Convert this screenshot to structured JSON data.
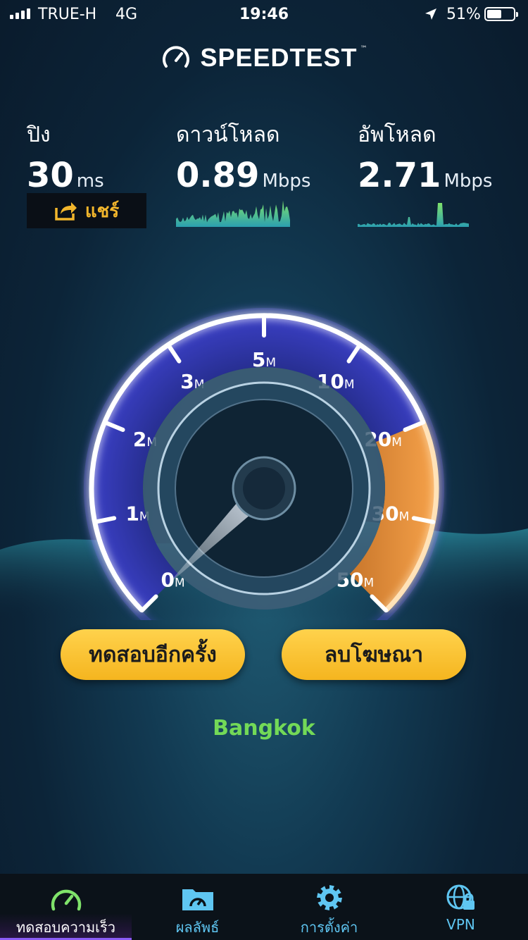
{
  "status": {
    "carrier": "TRUE-H",
    "network": "4G",
    "time": "19:46",
    "battery": "51%",
    "battery_level": 0.51
  },
  "app": {
    "title": "SPEEDTEST",
    "tm": "™"
  },
  "ping": {
    "label": "ปิง",
    "value": "30",
    "unit": "ms"
  },
  "download": {
    "label": "ดาวน์โหลด",
    "value": "0.89",
    "unit": "Mbps"
  },
  "upload": {
    "label": "อัพโหลด",
    "value": "2.71",
    "unit": "Mbps"
  },
  "share": {
    "label": "แชร์"
  },
  "gauge": {
    "ticks": [
      {
        "n": "0",
        "u": "M"
      },
      {
        "n": "1",
        "u": "M"
      },
      {
        "n": "2",
        "u": "M"
      },
      {
        "n": "3",
        "u": "M"
      },
      {
        "n": "5",
        "u": "M"
      },
      {
        "n": "10",
        "u": "M"
      },
      {
        "n": "20",
        "u": "M"
      },
      {
        "n": "30",
        "u": "M"
      },
      {
        "n": "50",
        "u": "M"
      }
    ],
    "needle_value_mbps": 0
  },
  "buttons": {
    "test_again": "ทดสอบอีกครั้ง",
    "remove_ads": "ลบโฆษณา"
  },
  "server_city": "Bangkok",
  "tabs": [
    {
      "label": "ทดสอบความเร็ว",
      "icon": "speedometer-icon"
    },
    {
      "label": "ผลลัพธ์",
      "icon": "results-folder-icon"
    },
    {
      "label": "การตั้งค่า",
      "icon": "gear-icon"
    },
    {
      "label": "VPN",
      "icon": "vpn-globe-lock-icon"
    }
  ],
  "colors": {
    "accent_yellow": "#f5b51f",
    "tab_blue": "#5fc6f2",
    "city_green": "#73d957",
    "gauge_orange": "#f39a3c"
  }
}
